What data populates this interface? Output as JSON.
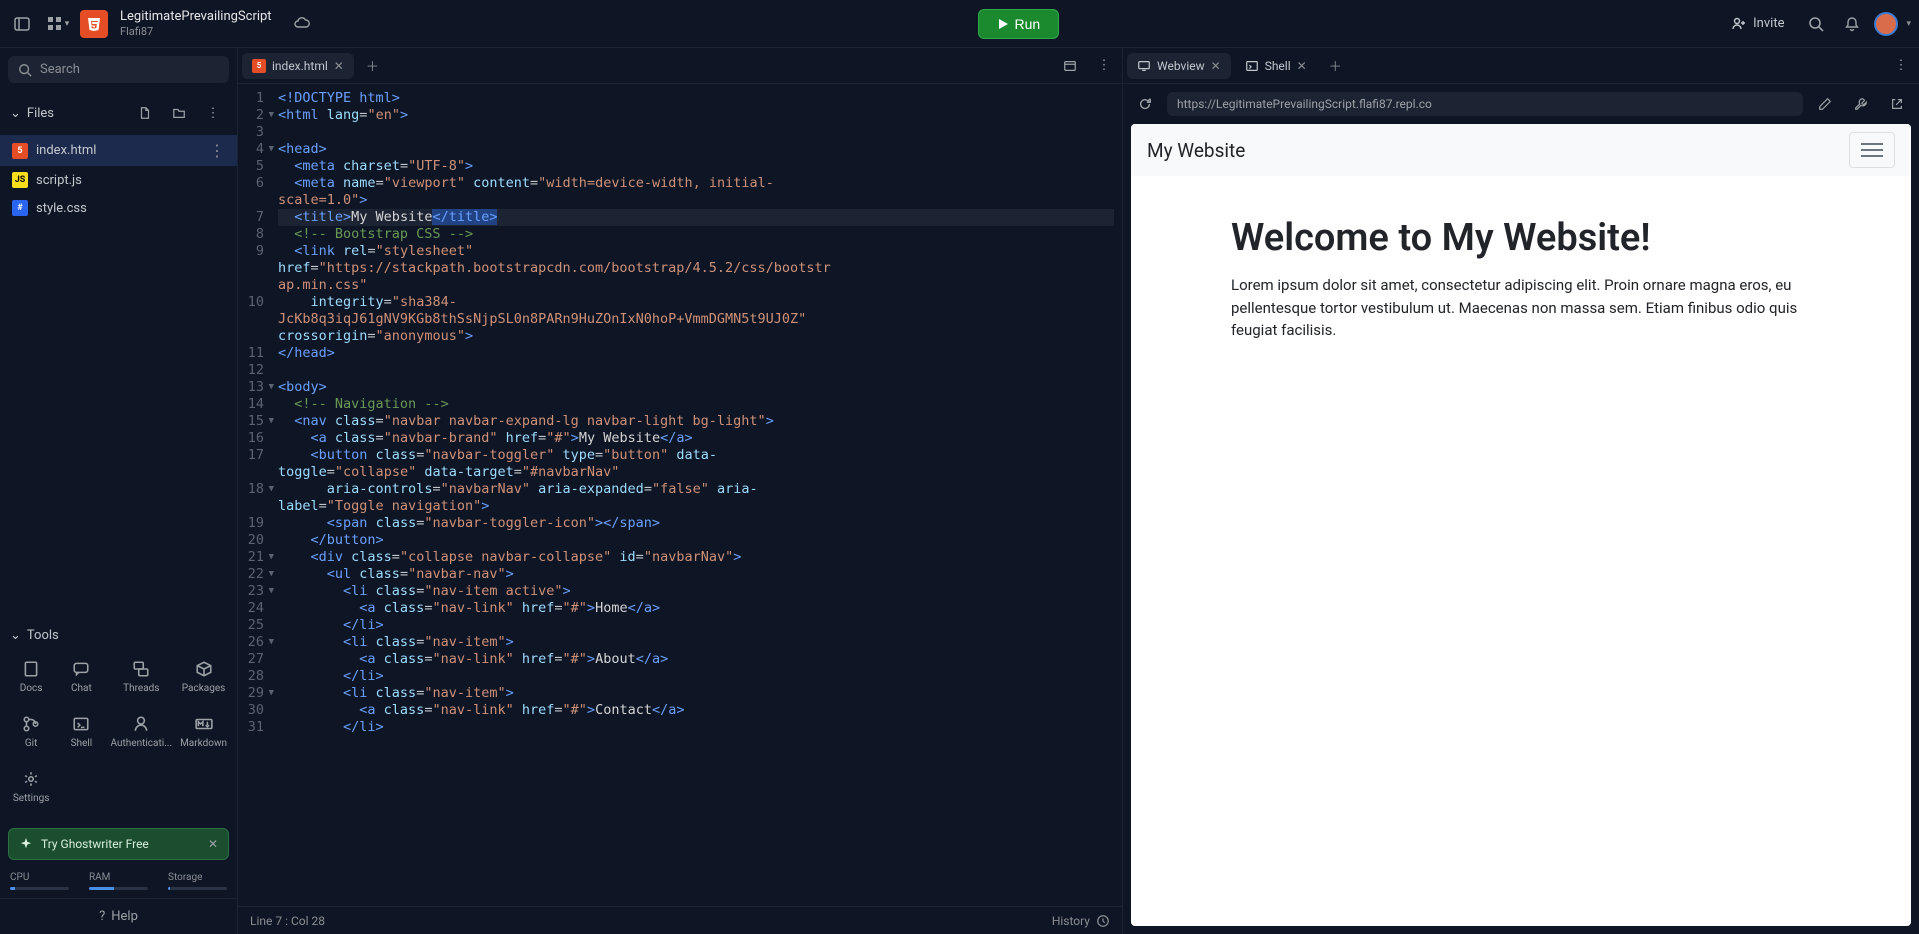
{
  "header": {
    "project_title": "LegitimatePrevailingScript",
    "project_owner": "Flafi87",
    "run_label": "Run",
    "invite_label": "Invite"
  },
  "sidebar": {
    "search_placeholder": "Search",
    "files_label": "Files",
    "files": [
      {
        "name": "index.html",
        "type": "html",
        "active": true
      },
      {
        "name": "script.js",
        "type": "js",
        "active": false
      },
      {
        "name": "style.css",
        "type": "css",
        "active": false
      }
    ],
    "tools_label": "Tools",
    "tools": [
      {
        "label": "Docs",
        "icon": "book"
      },
      {
        "label": "Chat",
        "icon": "chat"
      },
      {
        "label": "Threads",
        "icon": "threads"
      },
      {
        "label": "Packages",
        "icon": "package"
      },
      {
        "label": "Git",
        "icon": "git"
      },
      {
        "label": "Shell",
        "icon": "shell"
      },
      {
        "label": "Authenticati...",
        "icon": "auth"
      },
      {
        "label": "Markdown",
        "icon": "md"
      },
      {
        "label": "Settings",
        "icon": "settings"
      }
    ],
    "ghostwriter_label": "Try Ghostwriter Free",
    "resources": {
      "cpu_label": "CPU",
      "cpu_pct": 8,
      "ram_label": "RAM",
      "ram_pct": 42,
      "storage_label": "Storage",
      "storage_pct": 4
    },
    "help_label": "Help"
  },
  "editor": {
    "tab_label": "index.html",
    "status_left": "Line 7 : Col 28",
    "status_right": "History"
  },
  "preview": {
    "webview_tab": "Webview",
    "shell_tab": "Shell",
    "url": "https://LegitimatePrevailingScript.flafi87.repl.co",
    "navbar_brand": "My Website",
    "page_heading": "Welcome to My Website!",
    "page_body": "Lorem ipsum dolor sit amet, consectetur adipiscing elit. Proin ornare magna eros, eu pellentesque tortor vestibulum ut. Maecenas non massa sem. Etiam finibus odio quis feugiat facilisis."
  }
}
